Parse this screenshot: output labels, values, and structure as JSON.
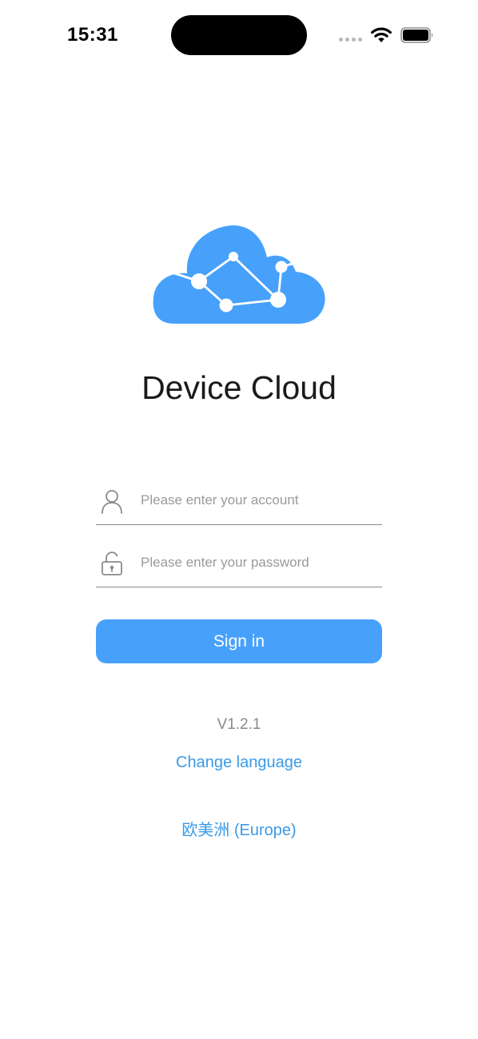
{
  "status_bar": {
    "time": "15:31"
  },
  "app": {
    "title": "Device Cloud",
    "logo_icon": "cloud-network-icon",
    "brand_color": "#47a1fb"
  },
  "form": {
    "account": {
      "icon": "user-icon",
      "value": "",
      "placeholder": "Please enter your account"
    },
    "password": {
      "icon": "lock-icon",
      "value": "",
      "placeholder": "Please enter your password"
    },
    "signin_label": "Sign in"
  },
  "footer": {
    "version": "V1.2.1",
    "change_language": "Change language",
    "region": "欧美洲 (Europe)",
    "link_color": "#3a9ae8"
  }
}
